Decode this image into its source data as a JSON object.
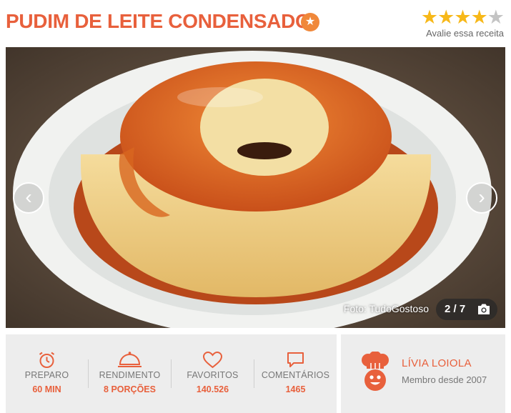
{
  "recipe": {
    "title": "PUDIM DE LEITE CONDENSADO",
    "badge_icon": "star-badge-icon",
    "rating": {
      "value": 4,
      "max": 5,
      "label": "Avalie essa receita"
    }
  },
  "gallery": {
    "credit": "Foto: TudoGostoso",
    "counter": "2 / 7",
    "prev_icon": "chevron-left-icon",
    "next_icon": "chevron-right-icon",
    "camera_icon": "camera-icon"
  },
  "stats": [
    {
      "icon": "timer-icon",
      "label": "PREPARO",
      "value": "60 MIN"
    },
    {
      "icon": "cloche-icon",
      "label": "RENDIMENTO",
      "value": "8 PORÇÕES"
    },
    {
      "icon": "heart-icon",
      "label": "FAVORITOS",
      "value": "140.526"
    },
    {
      "icon": "comment-icon",
      "label": "COMENTÁRIOS",
      "value": "1465"
    }
  ],
  "author": {
    "name": "LÍVIA LOIOLA",
    "since": "Membro desde 2007",
    "avatar_icon": "chef-avatar-icon"
  },
  "colors": {
    "brand": "#e8603c",
    "star": "#f7b819",
    "panel": "#ededed"
  }
}
